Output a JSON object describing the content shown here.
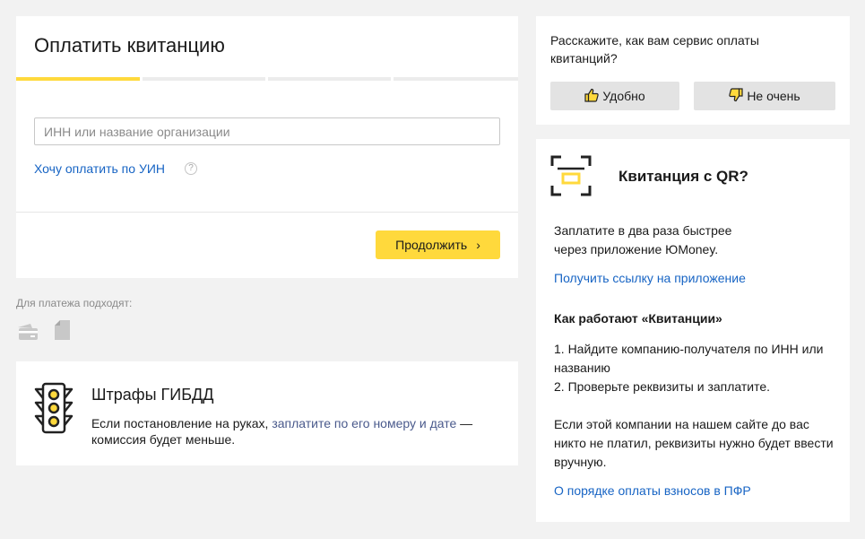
{
  "payment": {
    "title": "Оплатить квитанцию",
    "progress": {
      "steps": 4,
      "current_step": 1
    },
    "inn_placeholder": "ИНН или название организации",
    "inn_value": "",
    "uin_link": "Хочу оплатить по УИН",
    "help_glyph": "?",
    "continue_label": "Продолжить",
    "continue_chevron": "›",
    "accent_color": "#ffd93c"
  },
  "payment_methods": {
    "label": "Для платежа подходят:",
    "icons": [
      "card-icon",
      "receipt-icon"
    ]
  },
  "fines": {
    "icon": "traffic-light-icon",
    "title": "Штрафы ГИБДД",
    "text_before": "Если постановление на руках, ",
    "link_text": "заплатите по его номеру и дате",
    "text_after": " — комиссия будет меньше."
  },
  "feedback": {
    "question": "Расскажите, как вам сервис оплаты квитанций?",
    "positive_label": "Удобно",
    "negative_label": "Не очень"
  },
  "qr": {
    "icon": "qr-scan-icon",
    "title": "Квитанция с QR?",
    "description_line1": "Заплатите в два раза быстрее",
    "description_line2": "через приложение ЮMoney.",
    "app_link": "Получить ссылку на приложение",
    "how_title": "Как работают «Квитанции»",
    "step1": "1. Найдите компанию-получателя по ИНН или названию",
    "step2": "2. Проверьте реквизиты и заплатите.",
    "manual_note": "Если этой компании на нашем сайте до вас никто не платил, реквизиты нужно будет ввести вручную.",
    "pfr_link": "О порядке оплаты взносов в ПФР"
  }
}
